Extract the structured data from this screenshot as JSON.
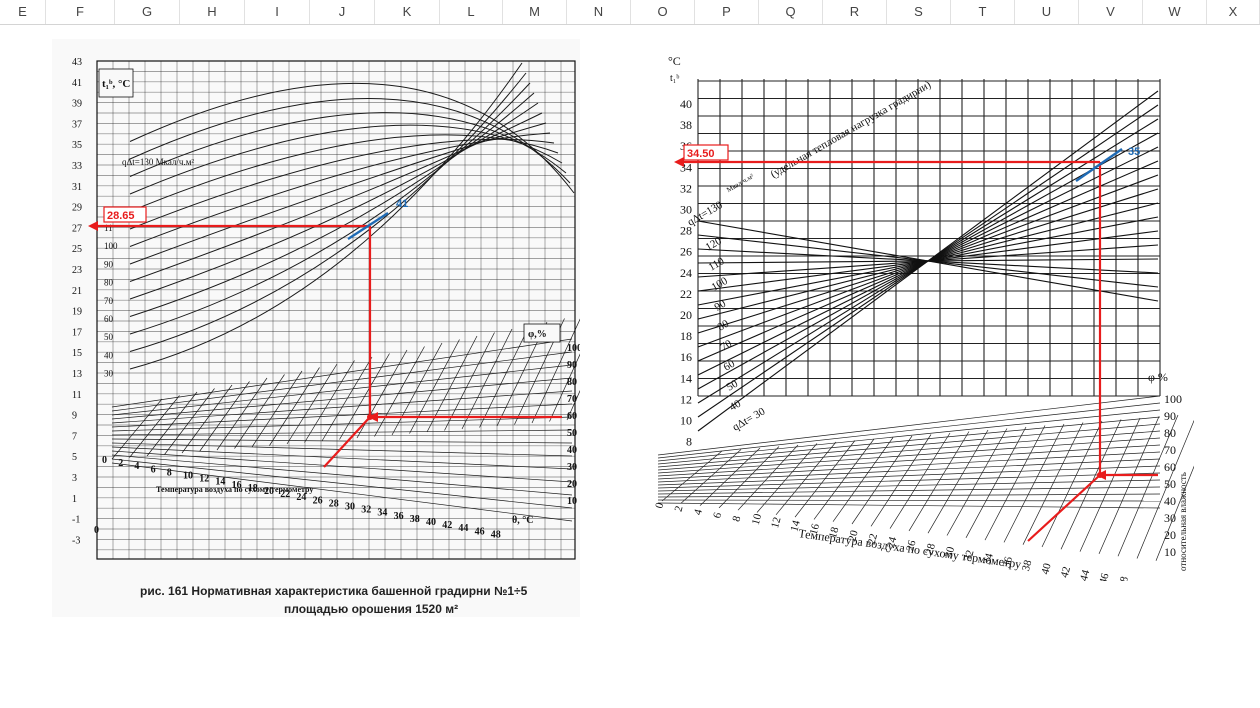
{
  "columns": [
    "E",
    "F",
    "G",
    "H",
    "I",
    "J",
    "K",
    "L",
    "M",
    "N",
    "O",
    "P",
    "Q",
    "R",
    "S",
    "T",
    "U",
    "V",
    "W",
    "X"
  ],
  "colors": {
    "red_marker": "#e81c1c",
    "blue_marker": "#1f6bb5",
    "grid": "#222222"
  },
  "left_chart": {
    "y_ticks": [
      "43",
      "41",
      "39",
      "37",
      "35",
      "33",
      "31",
      "29",
      "27",
      "25",
      "23",
      "21",
      "19",
      "17",
      "15",
      "13",
      "11",
      "9",
      "7",
      "5",
      "3",
      "1",
      "-1",
      "-3"
    ],
    "y_axis_label": "t₁ᵇ, °C",
    "q_label": "qΔt=130 Мкал/ч.м²",
    "q_ticks": [
      "11",
      "100",
      "90",
      "80",
      "70",
      "60",
      "50",
      "40",
      "30"
    ],
    "x_ticks": [
      "0",
      "2",
      "4",
      "6",
      "8",
      "10",
      "12",
      "14",
      "16",
      "18",
      "20",
      "22",
      "24",
      "26",
      "28",
      "30",
      "32",
      "34",
      "36",
      "38",
      "40",
      "42",
      "44",
      "46",
      "48"
    ],
    "x_title": "Температура воздуха по сухому термометру",
    "theta_label": "θ, °C",
    "zero_label": "0",
    "phi_label": "φ,%",
    "phi_ticks": [
      "100",
      "90",
      "80",
      "70",
      "60",
      "50",
      "40",
      "30",
      "20",
      "10"
    ],
    "result_value": "28.65",
    "blue_value": "41",
    "caption_line1": "рис.  161     Нормативная характеристика башенной градирни №1÷5",
    "caption_line2": "площадью орошения 1520 м²"
  },
  "right_chart": {
    "unit_label": "°C",
    "sub_label": "t₁ᵇ",
    "y_ticks": [
      "40",
      "38",
      "36",
      "34",
      "32",
      "30",
      "28",
      "26",
      "24",
      "22",
      "20",
      "18",
      "16",
      "14",
      "12",
      "10",
      "8"
    ],
    "q_label": "qΔt=130",
    "q_unit": "Мкал/ч.м²",
    "load_note": "(удельная тепловая нагрузка градирни)",
    "q_ticks": [
      "120",
      "110",
      "100",
      "90",
      "80",
      "70",
      "60",
      "50",
      "40",
      "qΔt= 30"
    ],
    "x_ticks": [
      "0",
      "2",
      "4",
      "6",
      "8",
      "10",
      "12",
      "14",
      "16",
      "18",
      "20",
      "22",
      "24",
      "26",
      "28",
      "30",
      "32",
      "34",
      "36",
      "38",
      "40",
      "42",
      "44",
      "46",
      "48"
    ],
    "x_title": "Температура воздуха по сухому термометру",
    "phi_label": "φ  %",
    "phi_ticks": [
      "100",
      "90",
      "80",
      "70",
      "60",
      "50",
      "40",
      "30",
      "20",
      "10"
    ],
    "side_note": "относительная влажность",
    "result_value": "34.50",
    "blue_value": "35"
  }
}
